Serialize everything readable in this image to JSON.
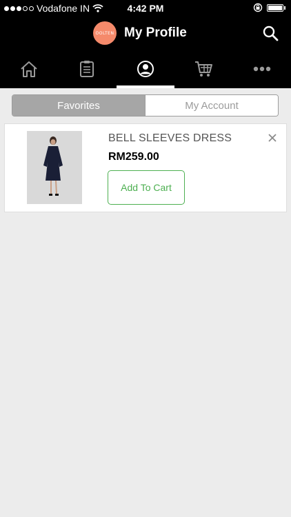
{
  "status_bar": {
    "carrier": "Vodafone IN",
    "time": "4:42 PM",
    "signal_dots_filled": 3,
    "signal_dots_total": 5
  },
  "header": {
    "title": "My Profile",
    "logo_text": "OOLTEN"
  },
  "tabs": [
    {
      "icon": "home-icon"
    },
    {
      "icon": "clipboard-icon"
    },
    {
      "icon": "profile-icon",
      "active": true
    },
    {
      "icon": "cart-icon"
    },
    {
      "icon": "more-icon"
    }
  ],
  "segments": {
    "favorites": "Favorites",
    "my_account": "My Account",
    "selected": "favorites"
  },
  "favorites": [
    {
      "name": "BELL SLEEVES DRESS",
      "price": "RM259.00",
      "add_to_cart": "Add To Cart"
    }
  ],
  "colors": {
    "accent_green": "#4caf50",
    "logo_bg": "#f58a6b",
    "header_bg": "#000000",
    "segment_active": "#a6a6a6"
  }
}
